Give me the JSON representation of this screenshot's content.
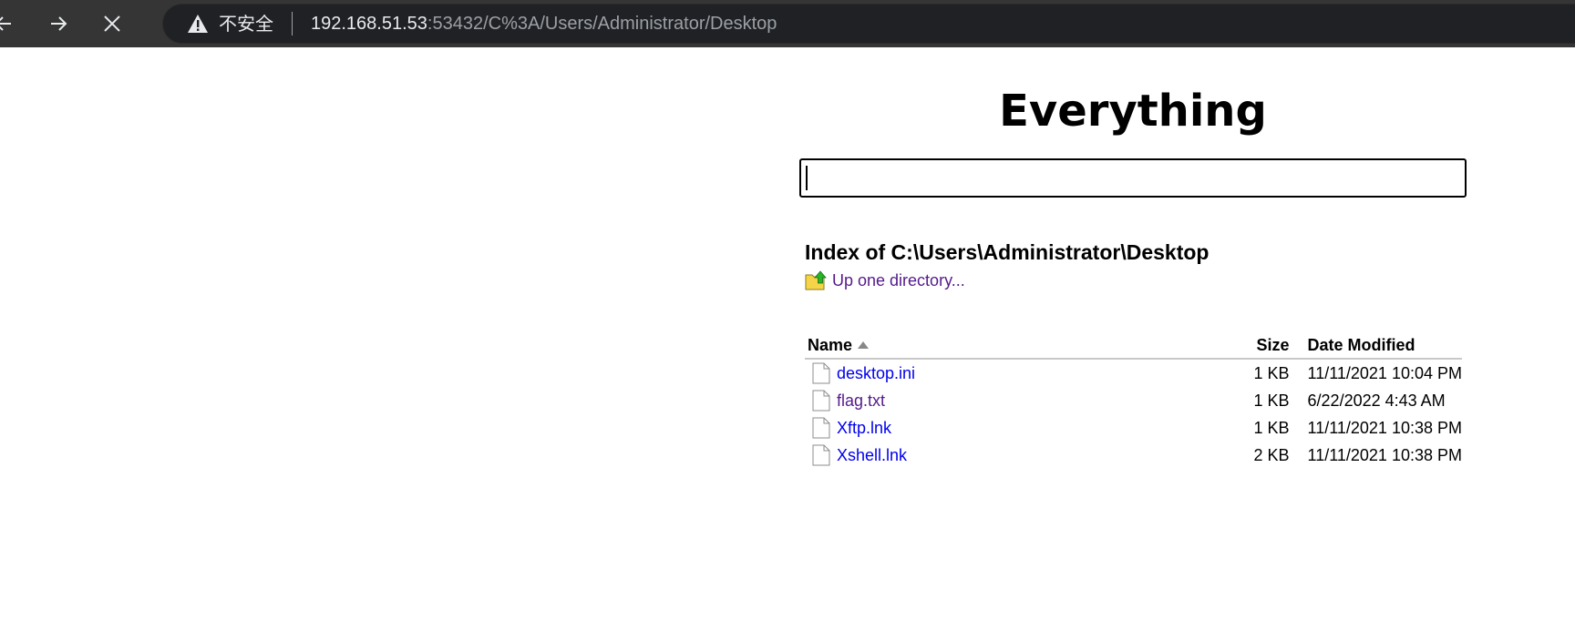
{
  "browser": {
    "security_label": "不安全",
    "url_host": "192.168.51.53",
    "url_rest": ":53432/C%3A/Users/Administrator/Desktop"
  },
  "page": {
    "logo_text": "Everything",
    "search": {
      "value": "",
      "placeholder": ""
    },
    "index_title": "Index of C:\\Users\\Administrator\\Desktop",
    "up_directory_label": "Up one directory..."
  },
  "table": {
    "headers": {
      "name": "Name",
      "size": "Size",
      "date": "Date Modified"
    },
    "sort": {
      "column": "name",
      "direction": "ascending"
    },
    "rows": [
      {
        "name": "desktop.ini",
        "size": "1 KB",
        "date": "11/11/2021 10:04 PM",
        "visited": false
      },
      {
        "name": "flag.txt",
        "size": "1 KB",
        "date": "6/22/2022 4:43 AM",
        "visited": true
      },
      {
        "name": "Xftp.lnk",
        "size": "1 KB",
        "date": "11/11/2021 10:38 PM",
        "visited": false
      },
      {
        "name": "Xshell.lnk",
        "size": "2 KB",
        "date": "11/11/2021 10:38 PM",
        "visited": false
      }
    ]
  },
  "colors": {
    "chrome_bg": "#353535",
    "omnibox_bg": "#202124",
    "link": "#0000ee",
    "visited_link": "#551a8b",
    "folder_yellow": "#f5d547",
    "up_arrow_green": "#27b427"
  },
  "icons": {
    "back": "arrow-left-icon",
    "forward": "arrow-right-icon",
    "stop": "close-icon",
    "security": "warning-triangle-icon",
    "up_directory": "folder-up-icon",
    "file": "file-icon",
    "sort": "sort-ascending-icon"
  }
}
